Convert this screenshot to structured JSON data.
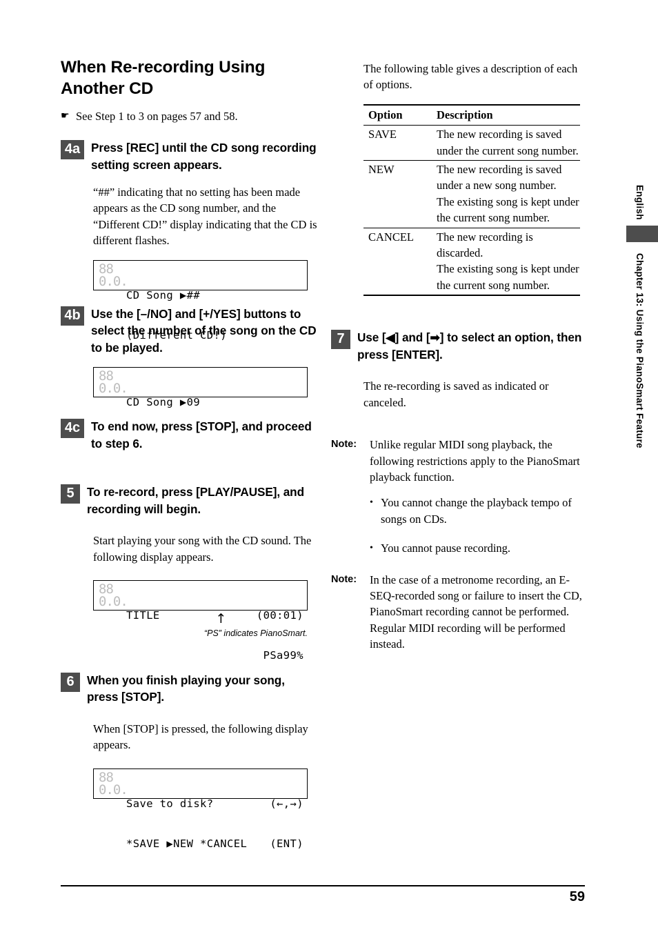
{
  "document": {
    "page_number": "59",
    "margin_rail": {
      "language_label": "English",
      "chapter_label": "Chapter 13: Using the PianoSmart Feature",
      "tab_color": "#4d4d4d"
    }
  },
  "left_column": {
    "heading": "When Re-recording Using Another CD",
    "see_step": {
      "icon": "☛",
      "text": "See Step 1 to 3 on pages 57 and 58."
    },
    "step_4a": {
      "badge": "4a",
      "instruction": "Press [REC] until the CD song recording setting screen appears.",
      "body": "“##” indicating that no setting has been made appears as the CD song number, and the “Different CD!” display indicating that the CD is different flashes.",
      "lcd": {
        "segment": "88",
        "segment_lower": "0.0.",
        "row1_left": "CD Song ▶##",
        "row1_right": "",
        "row2_left": "(Different CD!)",
        "row2_right": ""
      }
    },
    "step_4b": {
      "badge": "4b",
      "instruction": "Use the [–/NO] and [+/YES] buttons to select the number of the song on the CD to be played.",
      "lcd": {
        "segment": "88",
        "segment_lower": "0.0.",
        "row1_left": "CD Song ▶09",
        "row1_right": "",
        "row2_left": "",
        "row2_right": ""
      }
    },
    "step_4c": {
      "badge": "4c",
      "instruction": "To end now, press [STOP], and proceed to step 6."
    },
    "step_5": {
      "badge": "5",
      "instruction": "To re-record, press [PLAY/PAUSE], and recording will begin.",
      "body": "Start playing your song with the CD sound. The following display appears.",
      "lcd": {
        "segment": "88",
        "segment_lower": "0.0.",
        "row1_left": "TITLE",
        "row1_right": "(00:01)",
        "row2_left": "",
        "row2_right": "PSa99%"
      },
      "arrow": "↑",
      "caption": "“PS” indicates PianoSmart."
    },
    "step_6": {
      "badge": "6",
      "instruction": "When you finish playing your song, press [STOP].",
      "body": "When [STOP] is pressed, the following display appears.",
      "lcd": {
        "segment": "88",
        "segment_lower": "0.0.",
        "row1_left": "Save to disk?",
        "row1_right": "(←,→)",
        "row2_left": "*SAVE ▶NEW *CANCEL",
        "row2_right": "(ENT)"
      }
    }
  },
  "right_column": {
    "intro": "The following table gives a description of each of options.",
    "table": {
      "headers": [
        "Option",
        "Description"
      ],
      "rows": [
        {
          "option": "SAVE",
          "description": "The new recording is saved under the current song number."
        },
        {
          "option": "NEW",
          "description": "The new recording is saved under a new song number.\nThe existing song is kept under the current song number."
        },
        {
          "option": "CANCEL",
          "description": "The new recording is discarded.\nThe existing song is kept under the current song number."
        }
      ]
    },
    "step_7": {
      "badge": "7",
      "instruction": "Use [◀] and [➡] to select an option, then press [ENTER].",
      "body": "The re-recording is saved as indicated or canceled."
    },
    "note_1": {
      "label": "Note:",
      "body": "Unlike regular MIDI song playback, the following restrictions apply to the PianoSmart playback function.",
      "bullets": [
        "You cannot change the playback tempo of songs on CDs.",
        "You cannot pause recording."
      ]
    },
    "note_2": {
      "label": "Note:",
      "body": "In the case of a metronome recording, an E-SEQ-recorded song or failure to insert the CD, PianoSmart recording cannot be performed.  Regular MIDI recording will be performed instead."
    }
  }
}
